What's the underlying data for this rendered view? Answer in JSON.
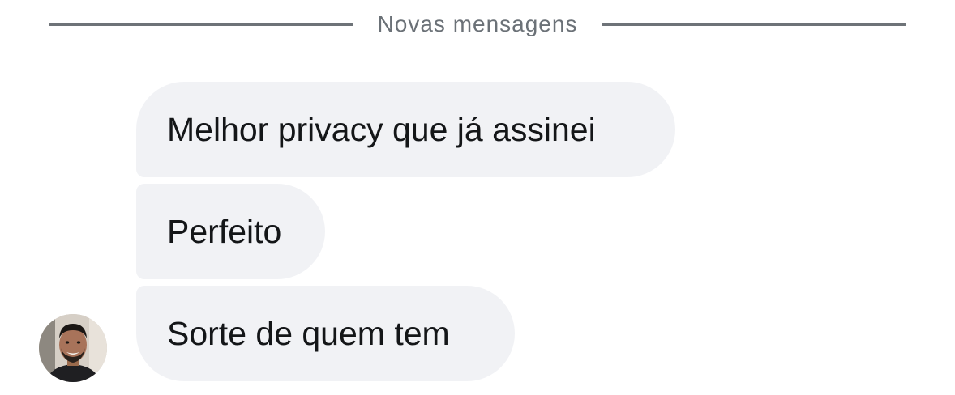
{
  "divider": {
    "label": "Novas mensagens"
  },
  "messages": [
    {
      "text": "Melhor privacy que já assinei"
    },
    {
      "text": "Perfeito"
    },
    {
      "text": "Sorte de quem tem"
    }
  ],
  "colors": {
    "bubble_bg": "#f1f2f5",
    "bubble_text": "#141618",
    "divider_line": "#6e7378",
    "divider_text": "#6b7177"
  },
  "avatar": {
    "icon": "user-avatar-photo"
  }
}
